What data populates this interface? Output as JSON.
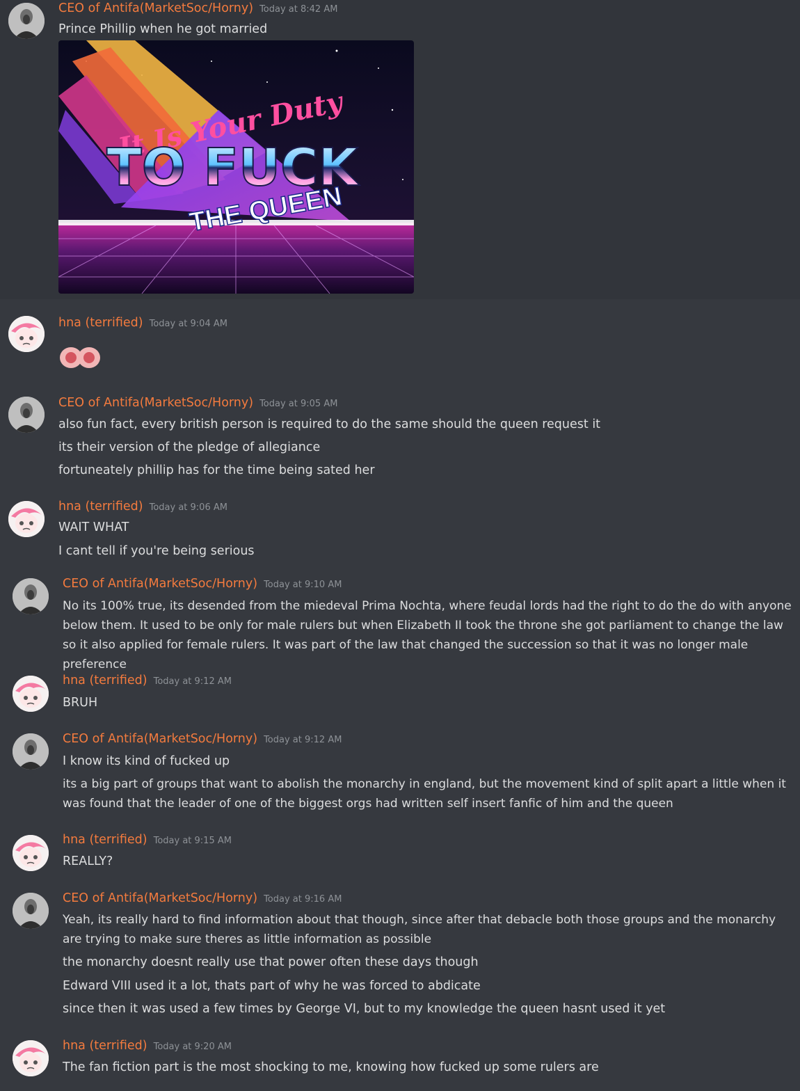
{
  "image": {
    "text_line1": "It Is Your Duty",
    "text_line2": "TO FUCK",
    "text_line3": "THE QUEEN"
  },
  "messages": [
    {
      "author": "CEO of Antifa(MarketSoc/Horny)",
      "timestamp": "Today at 8:42 AM",
      "lines": [
        "Prince Phillip when he got married"
      ]
    },
    {
      "author": "hna (terrified)",
      "timestamp": "Today at 9:04 AM",
      "emoji": "nipple-emoji-pair"
    },
    {
      "author": "CEO of Antifa(MarketSoc/Horny)",
      "timestamp": "Today at 9:05 AM",
      "lines": [
        "also fun fact, every british person is required to do the same should the queen request it",
        "its their version of the pledge of allegiance",
        "fortuneately phillip has for the time being sated her"
      ]
    },
    {
      "author": "hna (terrified)",
      "timestamp": "Today at 9:06 AM",
      "lines": [
        "WAIT WHAT",
        "I cant tell if you're being serious"
      ]
    },
    {
      "author": "CEO of Antifa(MarketSoc/Horny)",
      "timestamp": "Today at 9:10 AM",
      "lines": [
        "No its 100% true, its desended from the miedeval Prima Nochta, where feudal lords had the right to do the do with anyone below them. It used to be only for male rulers but when Elizabeth II took the throne she got parliament to change the law so it also applied for female rulers. It was part of the law that changed the succession so that it was no longer male preference"
      ]
    },
    {
      "author": "hna (terrified)",
      "timestamp": "Today at 9:12 AM",
      "lines": [
        "BRUH"
      ]
    },
    {
      "author": "CEO of Antifa(MarketSoc/Horny)",
      "timestamp": "Today at 9:12 AM",
      "lines": [
        "I know its kind of fucked up",
        "its a big part of groups that want to abolish the monarchy in england, but the movement kind of split apart a little when it was found that the leader of one of the biggest orgs had written self insert fanfic of him and the queen"
      ]
    },
    {
      "author": "hna (terrified)",
      "timestamp": "Today at 9:15 AM",
      "lines": [
        "REALLY?"
      ]
    },
    {
      "author": "CEO of Antifa(MarketSoc/Horny)",
      "timestamp": "Today at 9:16 AM",
      "lines": [
        "Yeah, its really hard to find information about that though, since after that debacle both those groups and the monarchy are trying to make sure theres as little information as possible",
        "the monarchy doesnt really use that power often these days though",
        "Edward VIII used it a lot, thats part of why he was forced to abdicate",
        "since then it was used a few times by George VI, but to my knowledge the queen hasnt used it yet"
      ]
    },
    {
      "author": "hna (terrified)",
      "timestamp": "Today at 9:20 AM",
      "lines": [
        "The fan fiction part is the most shocking to me, knowing how fucked up some rulers are"
      ]
    }
  ]
}
